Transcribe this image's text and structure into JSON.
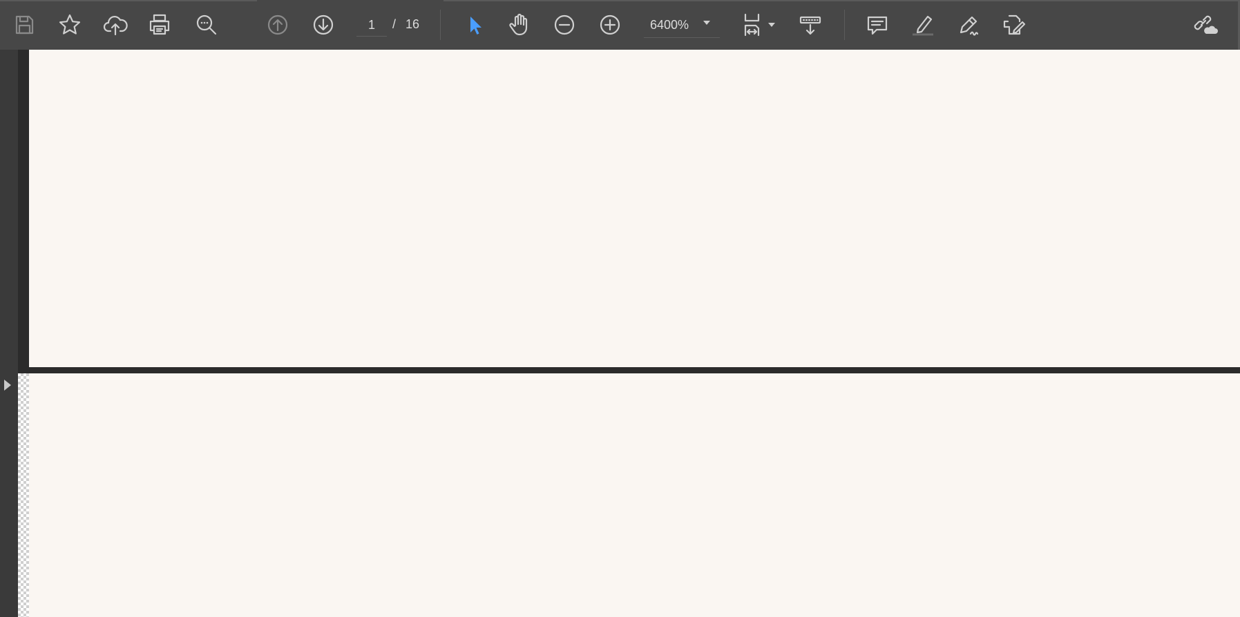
{
  "toolbar": {
    "save": {
      "icon": "save-icon"
    },
    "bookmark": {
      "icon": "star-icon"
    },
    "upload": {
      "icon": "cloud-upload-icon"
    },
    "print": {
      "icon": "printer-icon"
    },
    "find": {
      "icon": "search-more-icon"
    },
    "prev_page": {
      "icon": "arrow-up-circle-icon"
    },
    "next_page": {
      "icon": "arrow-down-circle-icon"
    },
    "page": {
      "current": "1",
      "separator": "/",
      "total": "16"
    },
    "select_tool": {
      "icon": "pointer-icon",
      "active_color": "#4a9eff"
    },
    "hand_tool": {
      "icon": "hand-icon"
    },
    "zoom_out": {
      "icon": "minus-circle-icon"
    },
    "zoom_in": {
      "icon": "plus-circle-icon"
    },
    "zoom": {
      "value": "6400%"
    },
    "fit_page": {
      "icon": "fit-width-icon"
    },
    "scroll_mode": {
      "icon": "scroll-mode-icon"
    },
    "comment": {
      "icon": "comment-icon"
    },
    "highlight": {
      "icon": "highlighter-icon"
    },
    "sign": {
      "icon": "pen-sign-icon"
    },
    "edit_pdf": {
      "icon": "edit-pdf-icon"
    },
    "share_link": {
      "icon": "link-cloud-icon"
    }
  },
  "colors": {
    "toolbar_bg": "#474747",
    "page_bg": "#faf6f2",
    "canvas_bg": "#2b2b2b",
    "accent": "#4a9eff"
  }
}
